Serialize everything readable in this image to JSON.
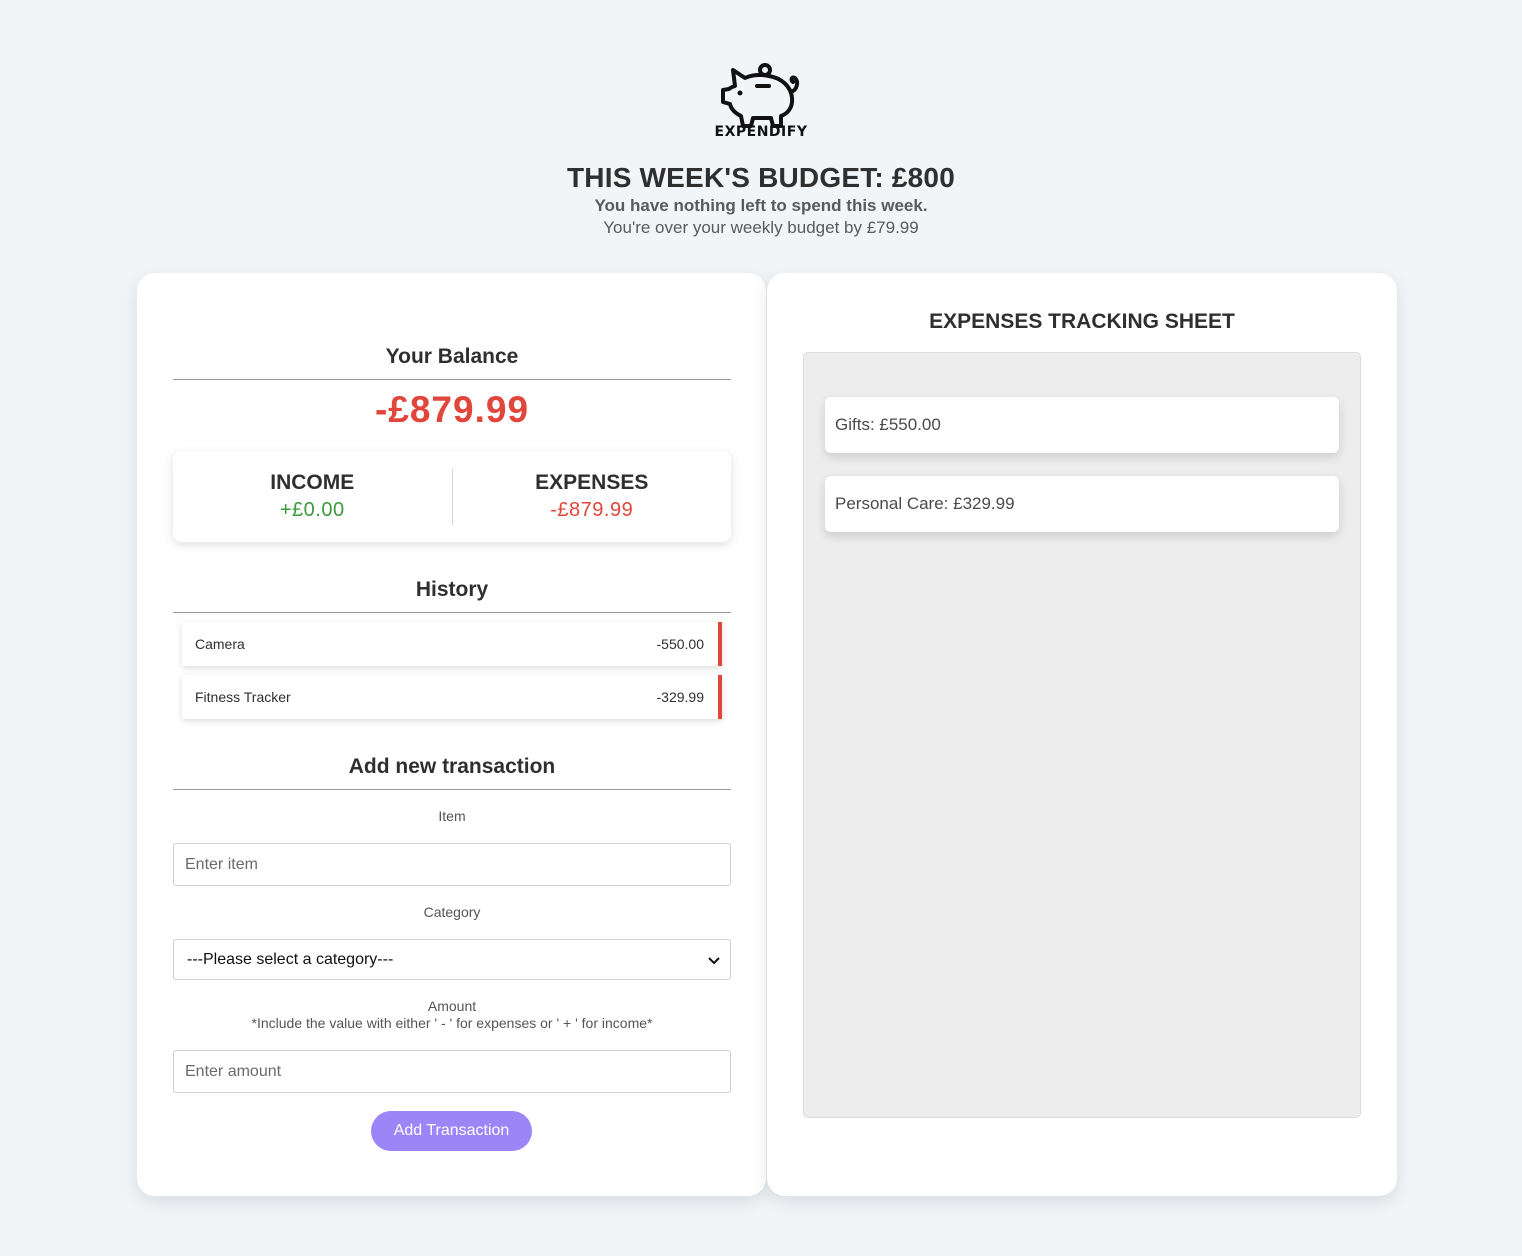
{
  "brand": {
    "name": "EXPENDIFY"
  },
  "budget": {
    "title": "THIS WEEK'S BUDGET: £800",
    "status": "You have nothing left to spend this week.",
    "over_message": "You're over your weekly budget by £79.99"
  },
  "balance": {
    "heading": "Your Balance",
    "value": "-£879.99"
  },
  "summary": {
    "income_label": "INCOME",
    "income_value": "+£0.00",
    "expenses_label": "EXPENSES",
    "expenses_value": "-£879.99",
    "income_color": "#3a9b3a",
    "expense_color": "#e0463c"
  },
  "history": {
    "heading": "History",
    "items": [
      {
        "name": "Camera",
        "amount": "-550.00"
      },
      {
        "name": "Fitness Tracker",
        "amount": "-329.99"
      }
    ]
  },
  "form": {
    "heading": "Add new transaction",
    "item_label": "Item",
    "item_placeholder": "Enter item",
    "category_label": "Category",
    "category_selected": "---Please select a category---",
    "amount_label": "Amount",
    "amount_hint": "*Include the value with either ' - ' for expenses or ' + ' for income*",
    "amount_placeholder": "Enter amount",
    "submit_label": "Add Transaction",
    "accent_color": "#9b85f7"
  },
  "tracking": {
    "heading": "EXPENSES TRACKING SHEET",
    "items": [
      {
        "text": "Gifts: £550.00"
      },
      {
        "text": "Personal Care: £329.99"
      }
    ]
  }
}
